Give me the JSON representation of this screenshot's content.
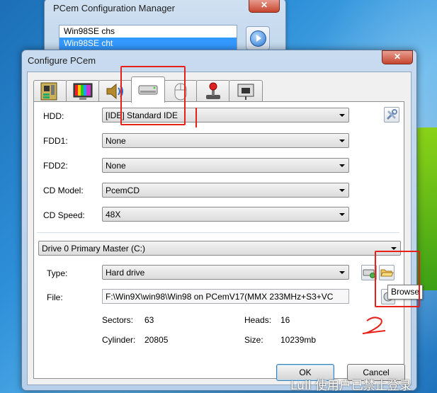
{
  "back_window": {
    "title": "PCem Configuration Manager",
    "close_label": "✕",
    "items": [
      "Win98SE chs",
      "Win98SE cht"
    ],
    "selected_index": 1
  },
  "dialog": {
    "title": "Configure PCem",
    "close_label": "✕",
    "tabs": [
      {
        "icon": "motherboard-icon"
      },
      {
        "icon": "display-icon"
      },
      {
        "icon": "speaker-icon"
      },
      {
        "icon": "hard-drive-icon"
      },
      {
        "icon": "mouse-icon"
      },
      {
        "icon": "joystick-icon"
      },
      {
        "icon": "network-icon"
      }
    ],
    "active_tab": 3,
    "fields": {
      "hdd": {
        "label": "HDD:",
        "value": "[IDE] Standard IDE"
      },
      "fdd1": {
        "label": "FDD1:",
        "value": "None"
      },
      "fdd2": {
        "label": "FDD2:",
        "value": "None"
      },
      "cd_model": {
        "label": "CD Model:",
        "value": "PcemCD"
      },
      "cd_speed": {
        "label": "CD Speed:",
        "value": "48X"
      }
    },
    "drive_select": "Drive 0 Primary Master (C:)",
    "type": {
      "label": "Type:",
      "value": "Hard drive"
    },
    "file": {
      "label": "File:",
      "value": "F:\\Win9X\\win98\\Win98 on PCemV17(MMX 233MHz+S3+VC"
    },
    "info": {
      "sectors_label": "Sectors:",
      "sectors": "63",
      "heads_label": "Heads:",
      "heads": "16",
      "cylinder_label": "Cylinder:",
      "cylinder": "20805",
      "size_label": "Size:",
      "size": "10239mb"
    },
    "tooltip": "Browse",
    "ok_label": "OK",
    "cancel_label": "Cancel"
  },
  "annotations": {
    "mark_1": "1",
    "mark_2": "2"
  },
  "watermark": "Lull 使用户已禁止登录",
  "colors": {
    "annotation": "#e8201a",
    "selection": "#3399ff"
  }
}
